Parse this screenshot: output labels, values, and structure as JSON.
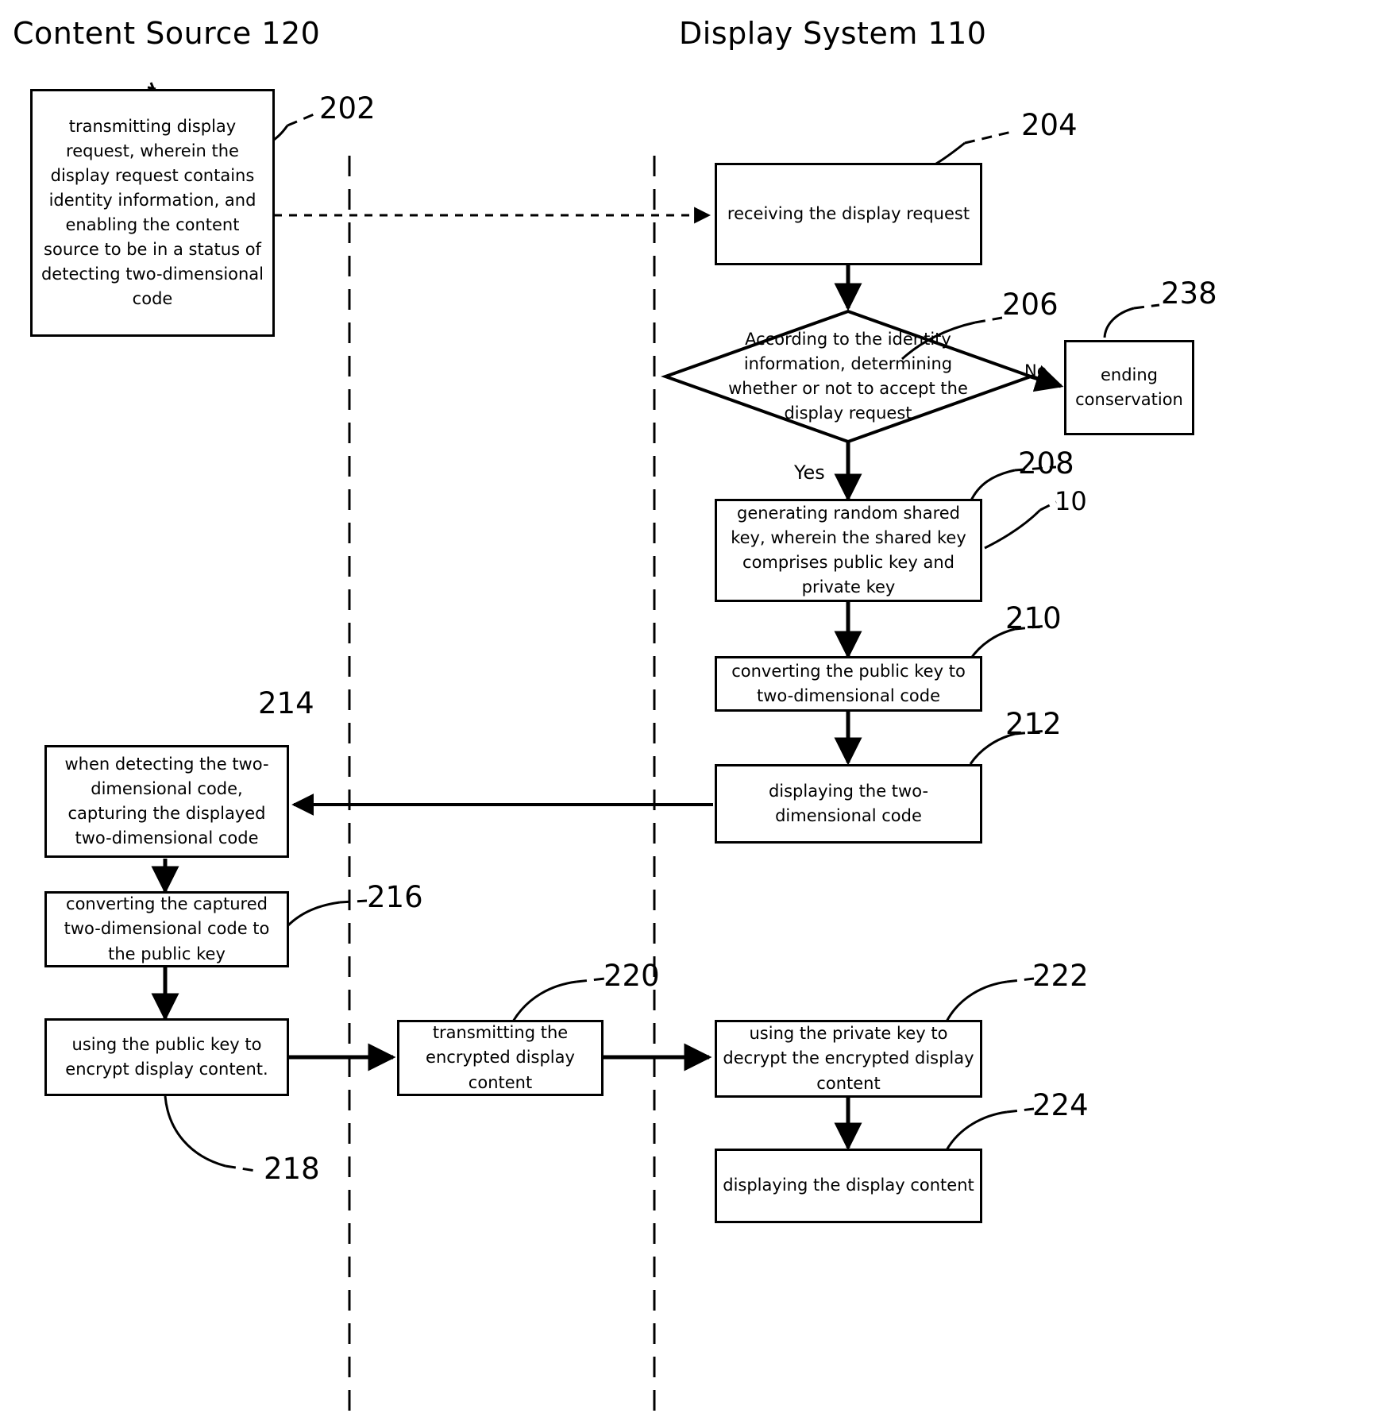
{
  "figure": {
    "type": "patent-flowchart",
    "lanes": [
      {
        "id": "content-source",
        "title": "Content Source 120"
      },
      {
        "id": "display-system",
        "title": "Display System 110"
      }
    ]
  },
  "nodes": {
    "n202": {
      "ref": "202",
      "shape": "process",
      "lane": "content-source",
      "text": "transmitting display request, wherein the display request contains identity information, and enabling the content source to be in a status of detecting two-dimensional code"
    },
    "n204": {
      "ref": "204",
      "shape": "process",
      "lane": "display-system",
      "text": "receiving the display request"
    },
    "n206": {
      "ref": "206",
      "shape": "decision",
      "lane": "display-system",
      "text": "According to the identity information, determining whether or not to accept the display request"
    },
    "n238": {
      "ref": "238",
      "shape": "process",
      "lane": "display-system",
      "text": "ending conservation"
    },
    "n208": {
      "ref": "208",
      "ref2": "10",
      "shape": "process",
      "lane": "display-system",
      "text": "generating random shared key, wherein the shared key comprises public key and private key"
    },
    "n210": {
      "ref": "210",
      "shape": "process",
      "lane": "display-system",
      "text": "converting the public key to two-dimensional code"
    },
    "n212": {
      "ref": "212",
      "shape": "process",
      "lane": "display-system",
      "text": "displaying the two-dimensional code"
    },
    "n214": {
      "ref": "214",
      "shape": "process",
      "lane": "content-source",
      "text": "when detecting the two-dimensional code, capturing the displayed two-dimensional code"
    },
    "n216": {
      "ref": "216",
      "shape": "process",
      "lane": "content-source",
      "text": "converting the captured two-dimensional code to the public key"
    },
    "n218": {
      "ref": "218",
      "shape": "process",
      "lane": "content-source",
      "text": "using the public key to encrypt display content."
    },
    "n220": {
      "ref": "220",
      "shape": "process",
      "lane": "content-source",
      "text": "transmitting the encrypted display content"
    },
    "n222": {
      "ref": "222",
      "shape": "process",
      "lane": "display-system",
      "text": "using the private key to decrypt the encrypted display content"
    },
    "n224": {
      "ref": "224",
      "shape": "process",
      "lane": "display-system",
      "text": "displaying the display content"
    }
  },
  "edge_labels": {
    "no": "No",
    "yes": "Yes"
  },
  "colors": {
    "stroke": "#000000",
    "background": "#ffffff"
  }
}
